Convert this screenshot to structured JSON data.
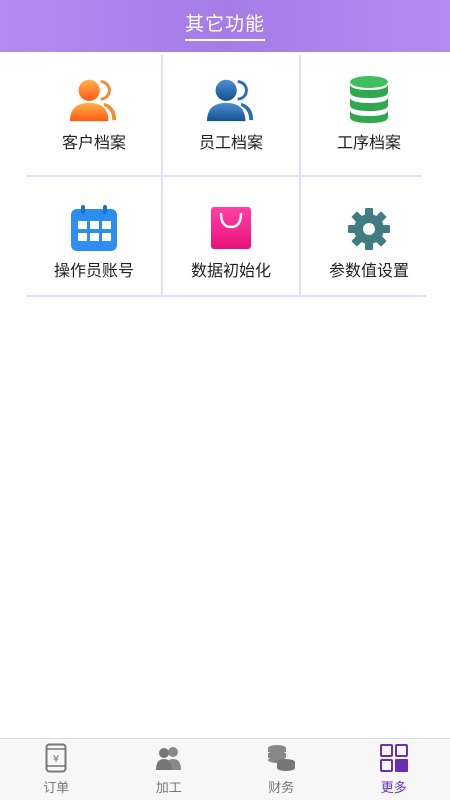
{
  "header": {
    "title": "其它功能"
  },
  "grid": {
    "items": [
      {
        "label": "客户档案",
        "icon": "customers-icon"
      },
      {
        "label": "员工档案",
        "icon": "employees-icon"
      },
      {
        "label": "工序档案",
        "icon": "database-icon"
      },
      {
        "label": "操作员账号",
        "icon": "calendar-icon"
      },
      {
        "label": "数据初始化",
        "icon": "shopping-bag-icon"
      },
      {
        "label": "参数值设置",
        "icon": "gear-icon"
      }
    ]
  },
  "tabbar": {
    "items": [
      {
        "label": "订单",
        "icon": "phone-yen-icon"
      },
      {
        "label": "加工",
        "icon": "people-icon"
      },
      {
        "label": "财务",
        "icon": "coins-icon"
      },
      {
        "label": "更多",
        "icon": "more-grid-icon",
        "active": true
      }
    ]
  },
  "colors": {
    "header": "#a57ce6",
    "grid_line": "#e6dcf7",
    "tab_active": "#6a2fb5",
    "tab_inactive": "#777777"
  }
}
